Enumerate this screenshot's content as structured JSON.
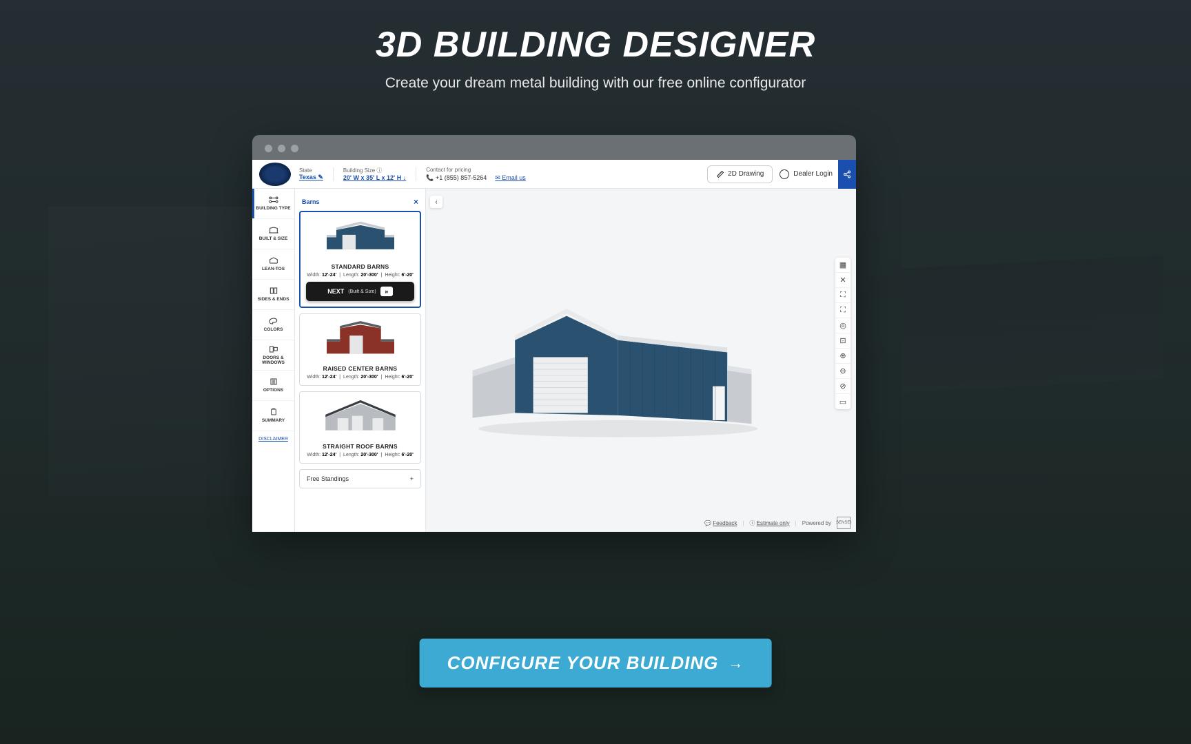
{
  "hero": {
    "title": "3D BUILDING DESIGNER",
    "subtitle": "Create your dream metal building with our free online configurator"
  },
  "cta": {
    "label": "CONFIGURE YOUR BUILDING"
  },
  "topbar": {
    "state_label": "State",
    "state_value": "Texas",
    "size_label": "Building Size",
    "size_value": "20' W x 35' L x 12' H",
    "contact_label": "Contact for pricing",
    "phone": "+1 (855) 857-5264",
    "email": "Email us",
    "drawing_btn": "2D Drawing",
    "dealer": "Dealer Login"
  },
  "sidenav": {
    "items": [
      {
        "label": "BUILDING TYPE"
      },
      {
        "label": "BUILT & SIZE"
      },
      {
        "label": "LEAN-TOS"
      },
      {
        "label": "SIDES & ENDS"
      },
      {
        "label": "COLORS"
      },
      {
        "label": "DOORS & WINDOWS"
      },
      {
        "label": "OPTIONS"
      },
      {
        "label": "SUMMARY"
      }
    ],
    "disclaimer": "DISCLAIMER"
  },
  "panel": {
    "title": "Barns",
    "cards": [
      {
        "title": "STANDARD BARNS",
        "width": "12'-24'",
        "length": "20'-300'",
        "height": "6'-20'",
        "next_label": "NEXT",
        "next_sub": "(Built & Size)"
      },
      {
        "title": "RAISED CENTER BARNS",
        "width": "12'-24'",
        "length": "20'-300'",
        "height": "6'-20'"
      },
      {
        "title": "STRAIGHT ROOF BARNS",
        "width": "12'-24'",
        "length": "20'-300'",
        "height": "6'-20'"
      }
    ],
    "accordion": "Free Standings"
  },
  "dims_labels": {
    "w": "Width:",
    "l": "Length:",
    "h": "Height:"
  },
  "footer": {
    "feedback": "Feedback",
    "estimate": "Estimate only",
    "powered": "Powered by",
    "brand": "SENSEI"
  }
}
